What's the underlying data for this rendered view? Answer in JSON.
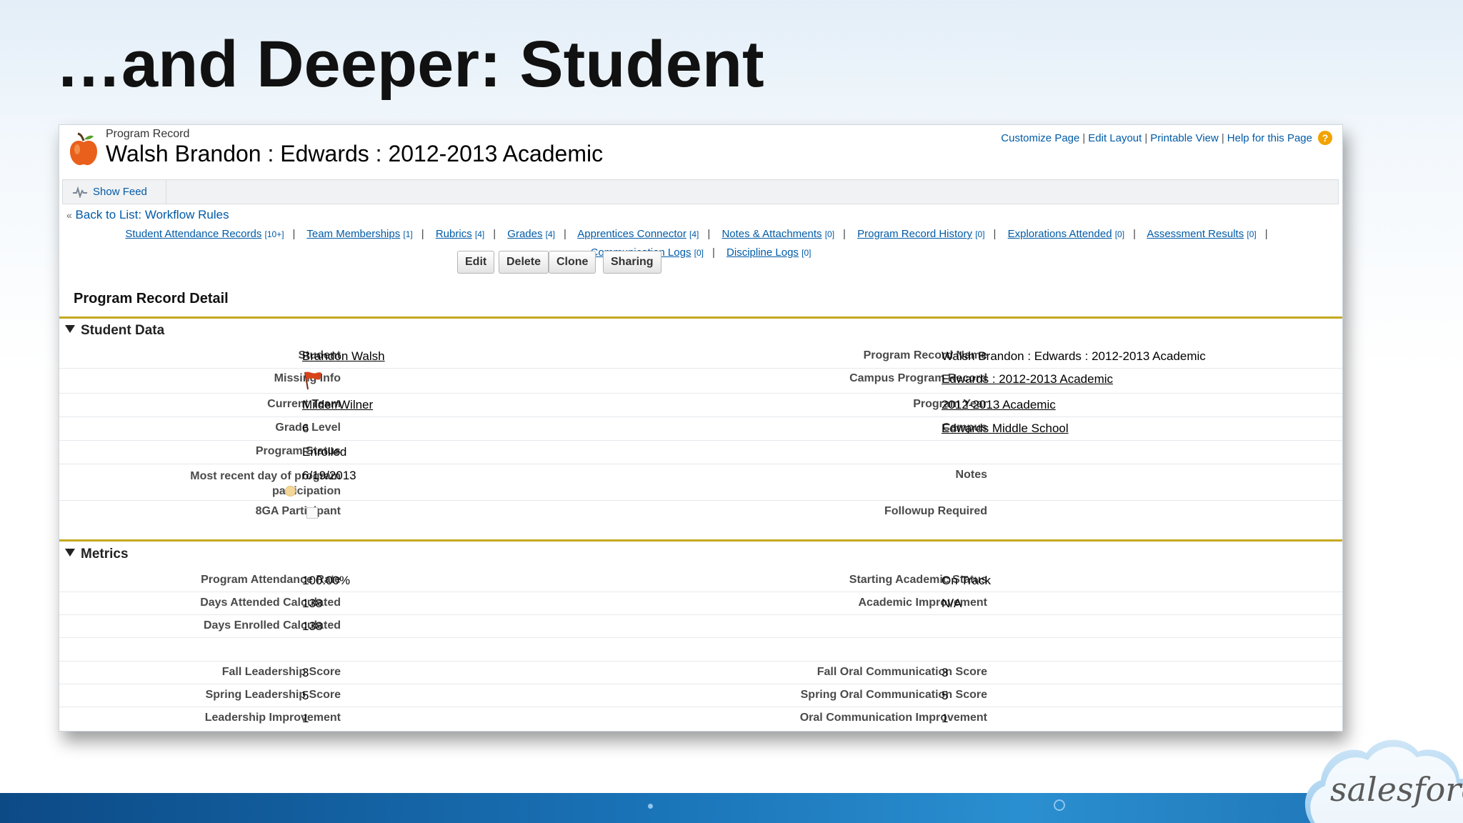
{
  "slide": {
    "title": "…and Deeper: Student"
  },
  "record": {
    "type_label": "Program Record",
    "title": "Walsh Brandon : Edwards : 2012-2013 Academic",
    "icon": "apple-icon"
  },
  "top_links": {
    "customize": "Customize Page",
    "edit_layout": "Edit Layout",
    "printable": "Printable View",
    "help": "Help for this Page",
    "help_icon_text": "?"
  },
  "feed": {
    "label": "Show Feed"
  },
  "back": {
    "prefix": "«",
    "label": "Back to List: Workflow Rules"
  },
  "related_lists": {
    "row1": [
      {
        "name": "Student Attendance Records",
        "count": "[10+]"
      },
      {
        "name": "Team Memberships",
        "count": "[1]"
      },
      {
        "name": "Rubrics",
        "count": "[4]"
      },
      {
        "name": "Grades",
        "count": "[4]"
      },
      {
        "name": "Apprentices Connector",
        "count": "[4]"
      },
      {
        "name": "Notes & Attachments",
        "count": "[0]"
      },
      {
        "name": "Program Record History",
        "count": "[0]"
      },
      {
        "name": "Explorations Attended",
        "count": "[0]"
      },
      {
        "name": "Assessment Results",
        "count": "[0]"
      }
    ],
    "row2": [
      {
        "name": "Communication Logs",
        "count": "[0]"
      },
      {
        "name": "Discipline Logs",
        "count": "[0]"
      }
    ],
    "separator": "|"
  },
  "detail": {
    "title": "Program Record Detail",
    "buttons": {
      "edit": "Edit",
      "delete": "Delete",
      "clone": "Clone",
      "sharing": "Sharing"
    }
  },
  "student_data": {
    "section_label": "Student Data",
    "student_label": "Student",
    "student_value": "Brandon Walsh",
    "missing_label": "Missing Info",
    "team_label": "Current Team",
    "team_value": "Milder/Wilner",
    "grade_label": "Grade Level",
    "grade_value": "6",
    "status_label": "Program Status",
    "status_value": "Enrolled",
    "recent_label_1": "Most recent day of program",
    "recent_label_2": "participation",
    "recent_value": "6/19/2013",
    "eightga_label": "8GA Participant",
    "prn_label": "Program Record Name",
    "prn_value": "Walsh Brandon : Edwards : 2012-2013 Academic",
    "cpr_label": "Campus Program Record",
    "cpr_value": "Edwards : 2012-2013 Academic",
    "year_label": "Program Year",
    "year_value": "2012-2013 Academic",
    "campus_label": "Campus",
    "campus_value": "Edwards Middle School",
    "notes_label": "Notes",
    "followup_label": "Followup Required"
  },
  "metrics": {
    "section_label": "Metrics",
    "attendance_rate_label": "Program Attendance Rate",
    "attendance_rate_value": "100.00%",
    "days_attended_label": "Days Attended Calculated",
    "days_attended_value": "138",
    "days_enrolled_label": "Days Enrolled Calculated",
    "days_enrolled_value": "138",
    "start_status_label": "Starting Academic Status",
    "start_status_value": "On Track",
    "acad_impr_label": "Academic Improvement",
    "acad_impr_value": "N/A",
    "fall_lead_label": "Fall Leadership Score",
    "fall_lead_value": "3",
    "spring_lead_label": "Spring Leadership Score",
    "spring_lead_value": "5",
    "lead_impr_label": "Leadership Improvement",
    "lead_impr_value": "1",
    "fall_oral_label": "Fall Oral Communication Score",
    "fall_oral_value": "3",
    "spring_oral_label": "Spring Oral Communication Score",
    "spring_oral_value": "5",
    "oral_impr_label": "Oral Communication Improvement",
    "oral_impr_value": "1"
  },
  "brand": {
    "logo_text": "salesforce",
    "accent": "#c5a922",
    "link_color": "#015ba7"
  }
}
